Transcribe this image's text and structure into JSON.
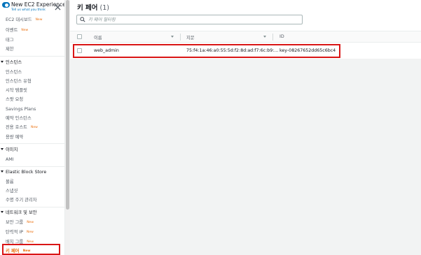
{
  "experience": {
    "title": "New EC2 Experience",
    "subtitle": "Tell us what you think"
  },
  "sidebar": {
    "badge_new": "New",
    "items": [
      {
        "label": "EC2 대시보드",
        "new": true
      },
      {
        "label": "이벤트",
        "new": true
      },
      {
        "label": "태그",
        "new": false
      },
      {
        "label": "제한",
        "new": false
      }
    ],
    "sections": [
      {
        "title": "인스턴스",
        "items": [
          {
            "label": "인스턴스",
            "new": false
          },
          {
            "label": "인스턴스 유형",
            "new": false
          },
          {
            "label": "시작 템플릿",
            "new": false
          },
          {
            "label": "스팟 요청",
            "new": false
          },
          {
            "label": "Savings Plans",
            "new": false
          },
          {
            "label": "예약 인스턴스",
            "new": false
          },
          {
            "label": "전용 호스트",
            "new": true
          },
          {
            "label": "용량 예약",
            "new": false
          }
        ]
      },
      {
        "title": "이미지",
        "items": [
          {
            "label": "AMI",
            "new": false
          }
        ]
      },
      {
        "title": "Elastic Block Store",
        "items": [
          {
            "label": "볼륨",
            "new": false
          },
          {
            "label": "스냅샷",
            "new": false
          },
          {
            "label": "수명 주기 관리자",
            "new": false
          }
        ]
      },
      {
        "title": "네트워크 및 보안",
        "items": [
          {
            "label": "보안 그룹",
            "new": true
          },
          {
            "label": "탄력적 IP",
            "new": true
          },
          {
            "label": "배치 그룹",
            "new": true
          },
          {
            "label": "키 페어",
            "new": true,
            "active": true
          }
        ]
      }
    ]
  },
  "main": {
    "title": "키 페어",
    "count": "(1)",
    "search_placeholder": "키 페어 필터링",
    "columns": [
      "이름",
      "지문",
      "ID"
    ],
    "rows": [
      {
        "name": "web_admin",
        "fingerprint": "75:f4:1a:46:a0:55:5d:f2:8d:ad:f7:6c:b9:...",
        "id": "key-08267652dd65c6bc4"
      }
    ]
  },
  "colors": {
    "accent": "#ec7211",
    "link": "#0073bb",
    "highlight": "#d91515"
  }
}
